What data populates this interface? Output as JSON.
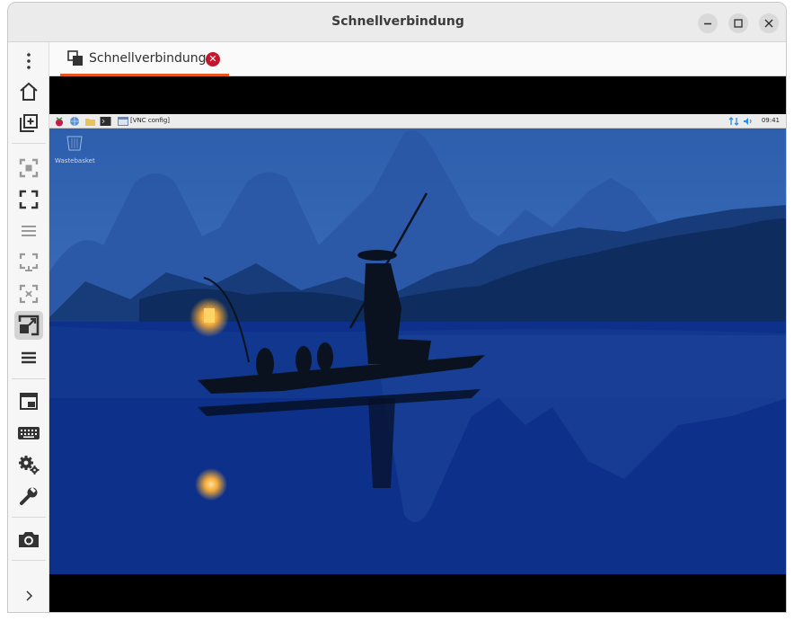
{
  "window": {
    "title": "Schnellverbindung",
    "controls": {
      "minimize": "–",
      "maximize": "□",
      "close": "✕"
    }
  },
  "sidebar": {
    "items": [
      {
        "name": "menu",
        "icon": "kebab-menu-icon"
      },
      {
        "name": "home",
        "icon": "home-icon"
      },
      {
        "name": "new-connection",
        "icon": "add-tab-icon"
      },
      {
        "name": "toggle-fullscreen",
        "icon": "fullscreen-focus-icon"
      },
      {
        "name": "scaled-fullscreen",
        "icon": "fullscreen-corners-icon"
      },
      {
        "name": "toolbar-lines",
        "icon": "lines-icon"
      },
      {
        "name": "viewport-fullscreen",
        "icon": "viewport-fullscreen-icon"
      },
      {
        "name": "dynamic-resize",
        "icon": "dynamic-resize-icon"
      },
      {
        "name": "scaled-mode",
        "icon": "scaled-mode-icon",
        "active": true
      },
      {
        "name": "preferences-menu",
        "icon": "hamburger-icon"
      },
      {
        "name": "switch-tab",
        "icon": "window-switch-icon"
      },
      {
        "name": "keyboard-grab",
        "icon": "keyboard-icon"
      },
      {
        "name": "settings",
        "icon": "gears-icon"
      },
      {
        "name": "tools",
        "icon": "wrench-icon"
      },
      {
        "name": "screenshot",
        "icon": "camera-icon"
      },
      {
        "name": "expand",
        "icon": "chevron-right-icon"
      }
    ]
  },
  "tabs": [
    {
      "label": "Schnellverbindung",
      "icon": "connection-icon",
      "close_icon": "✕"
    }
  ],
  "remote": {
    "taskbar_task": "[VNC config]",
    "clock": "09:41",
    "desktop_icon_label": "Wastebasket"
  },
  "colors": {
    "accent": "#e95420",
    "close_badge": "#c7162b",
    "network_icon": "#2a8ee6"
  }
}
